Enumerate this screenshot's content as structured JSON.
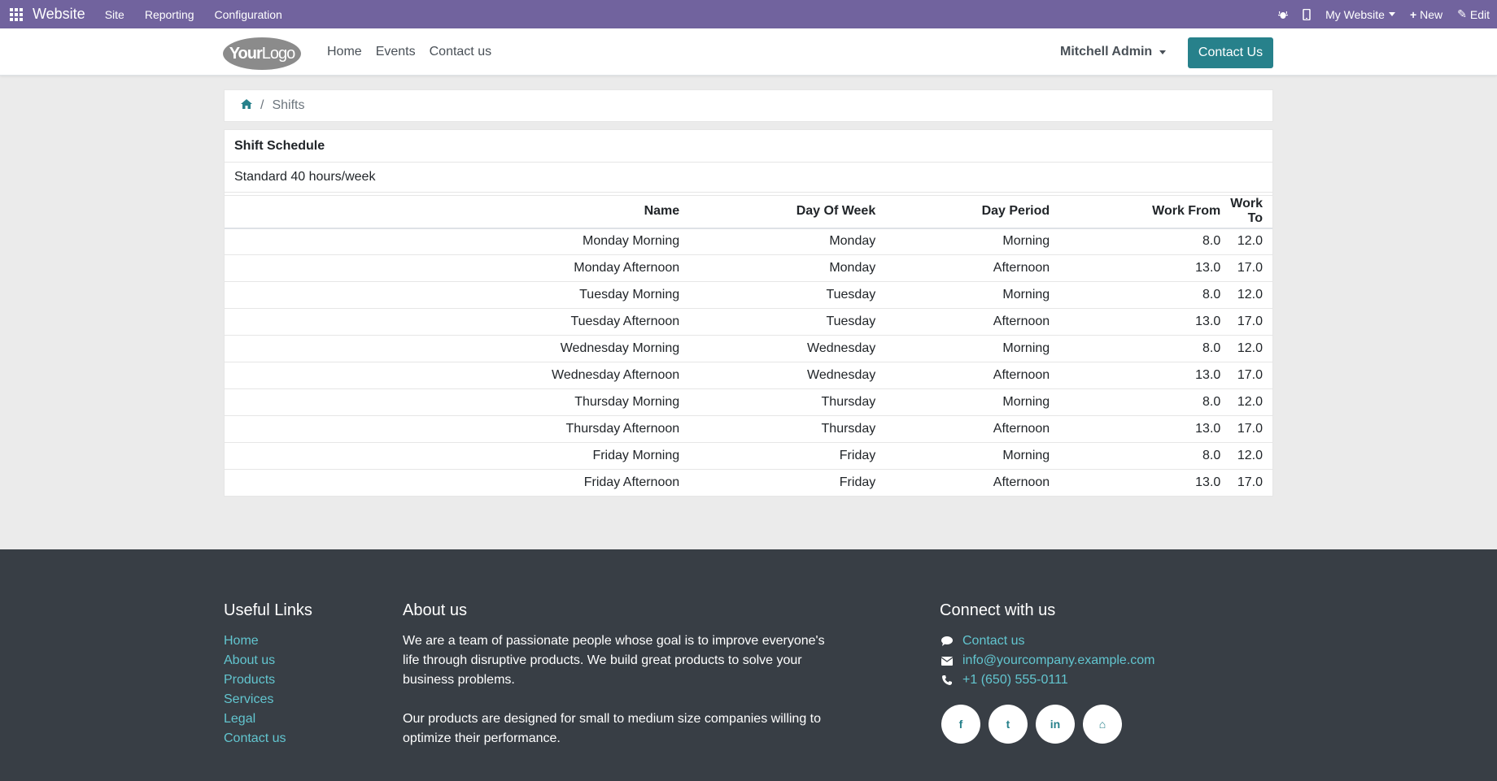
{
  "admin_bar": {
    "app_name": "Website",
    "menus": [
      "Site",
      "Reporting",
      "Configuration"
    ],
    "website_selector": "My Website",
    "new_label": "New",
    "edit_label": "Edit"
  },
  "header": {
    "logo_part1": "Your",
    "logo_part2": "Logo",
    "nav": [
      "Home",
      "Events",
      "Contact us"
    ],
    "user": "Mitchell Admin",
    "cta": "Contact Us"
  },
  "breadcrumb": {
    "current": "Shifts"
  },
  "schedule": {
    "title": "Shift Schedule",
    "subtitle": "Standard 40 hours/week",
    "columns": [
      "Name",
      "Day Of Week",
      "Day Period",
      "Work From",
      "Work To"
    ],
    "rows": [
      [
        "Monday Morning",
        "Monday",
        "Morning",
        "8.0",
        "12.0"
      ],
      [
        "Monday Afternoon",
        "Monday",
        "Afternoon",
        "13.0",
        "17.0"
      ],
      [
        "Tuesday Morning",
        "Tuesday",
        "Morning",
        "8.0",
        "12.0"
      ],
      [
        "Tuesday Afternoon",
        "Tuesday",
        "Afternoon",
        "13.0",
        "17.0"
      ],
      [
        "Wednesday Morning",
        "Wednesday",
        "Morning",
        "8.0",
        "12.0"
      ],
      [
        "Wednesday Afternoon",
        "Wednesday",
        "Afternoon",
        "13.0",
        "17.0"
      ],
      [
        "Thursday Morning",
        "Thursday",
        "Morning",
        "8.0",
        "12.0"
      ],
      [
        "Thursday Afternoon",
        "Thursday",
        "Afternoon",
        "13.0",
        "17.0"
      ],
      [
        "Friday Morning",
        "Friday",
        "Morning",
        "8.0",
        "12.0"
      ],
      [
        "Friday Afternoon",
        "Friday",
        "Afternoon",
        "13.0",
        "17.0"
      ]
    ]
  },
  "footer": {
    "links_title": "Useful Links",
    "links": [
      "Home",
      "About us",
      "Products",
      "Services",
      "Legal",
      "Contact us"
    ],
    "about_title": "About us",
    "about_p1": "We are a team of passionate people whose goal is to improve everyone's life through disruptive products. We build great products to solve your business problems.",
    "about_p2": "Our products are designed for small to medium size companies willing to optimize their performance.",
    "connect_title": "Connect with us",
    "contact_link": "Contact us",
    "email": "info@yourcompany.example.com",
    "phone": "+1 (650) 555-0111",
    "socials": [
      {
        "name": "facebook-icon",
        "glyph": "f"
      },
      {
        "name": "twitter-icon",
        "glyph": "t"
      },
      {
        "name": "linkedin-icon",
        "glyph": "in"
      },
      {
        "name": "home-icon",
        "glyph": "⌂"
      }
    ]
  }
}
